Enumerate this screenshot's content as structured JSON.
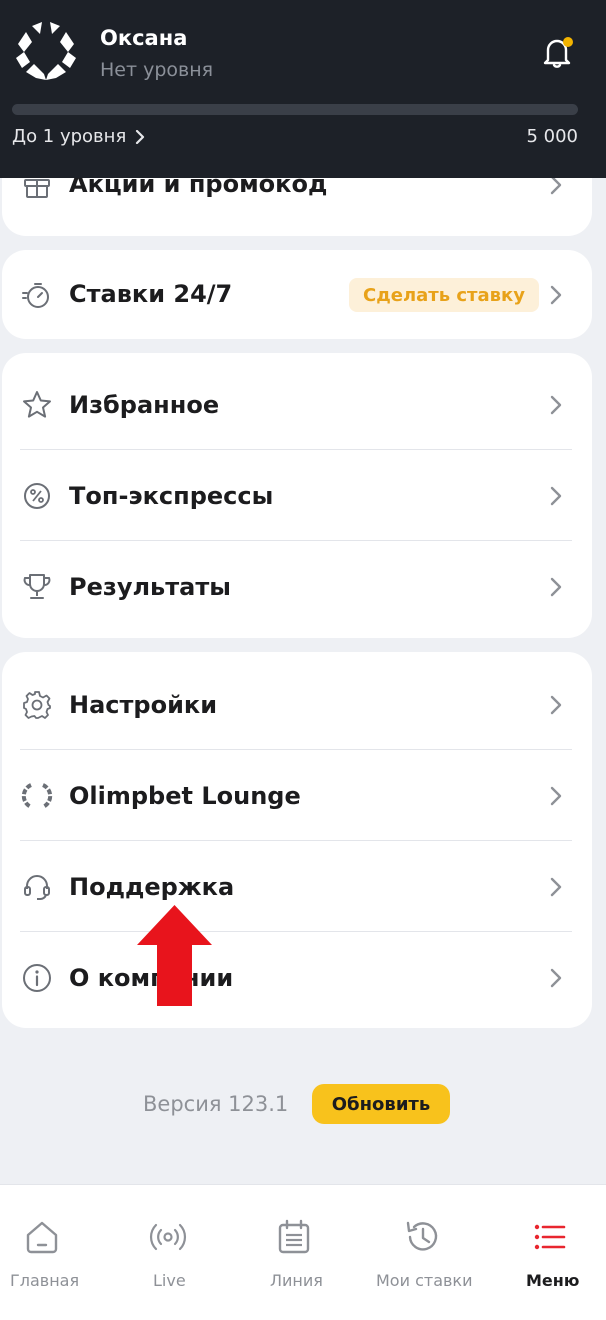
{
  "header": {
    "user_name": "Оксана",
    "user_level": "Нет уровня",
    "progress_label": "До 1 уровня",
    "progress_value": "5 000",
    "progress_fraction": 0.0,
    "notification_dot_color": "#f2b300"
  },
  "menu": {
    "promo": {
      "label": "Акции и промокод"
    },
    "bets247": {
      "label": "Ставки 24/7",
      "badge": "Сделать ставку"
    },
    "group2": [
      {
        "label": "Избранное",
        "icon": "star-icon"
      },
      {
        "label": "Топ-экспрессы",
        "icon": "percent-badge-icon"
      },
      {
        "label": "Результаты",
        "icon": "trophy-icon"
      }
    ],
    "group3": [
      {
        "label": "Настройки",
        "icon": "gear-icon"
      },
      {
        "label": "Olimpbet Lounge",
        "icon": "lounge-laurel-icon"
      },
      {
        "label": "Поддержка",
        "icon": "headset-icon"
      },
      {
        "label": "О компании",
        "icon": "info-icon"
      }
    ]
  },
  "footer": {
    "version": "Версия 123.1",
    "update_label": "Обновить"
  },
  "bottom_nav": [
    {
      "label": "Главная",
      "icon": "home-icon"
    },
    {
      "label": "Live",
      "icon": "broadcast-icon"
    },
    {
      "label": "Линия",
      "icon": "calendar-icon"
    },
    {
      "label": "Мои ставки",
      "icon": "history-icon"
    },
    {
      "label": "Меню",
      "icon": "menu-list-icon",
      "active": true
    }
  ],
  "colors": {
    "header_bg": "#1d2128",
    "accent_yellow": "#f8c21c",
    "active_red": "#e8262f",
    "annotation_red": "#e8141c"
  }
}
